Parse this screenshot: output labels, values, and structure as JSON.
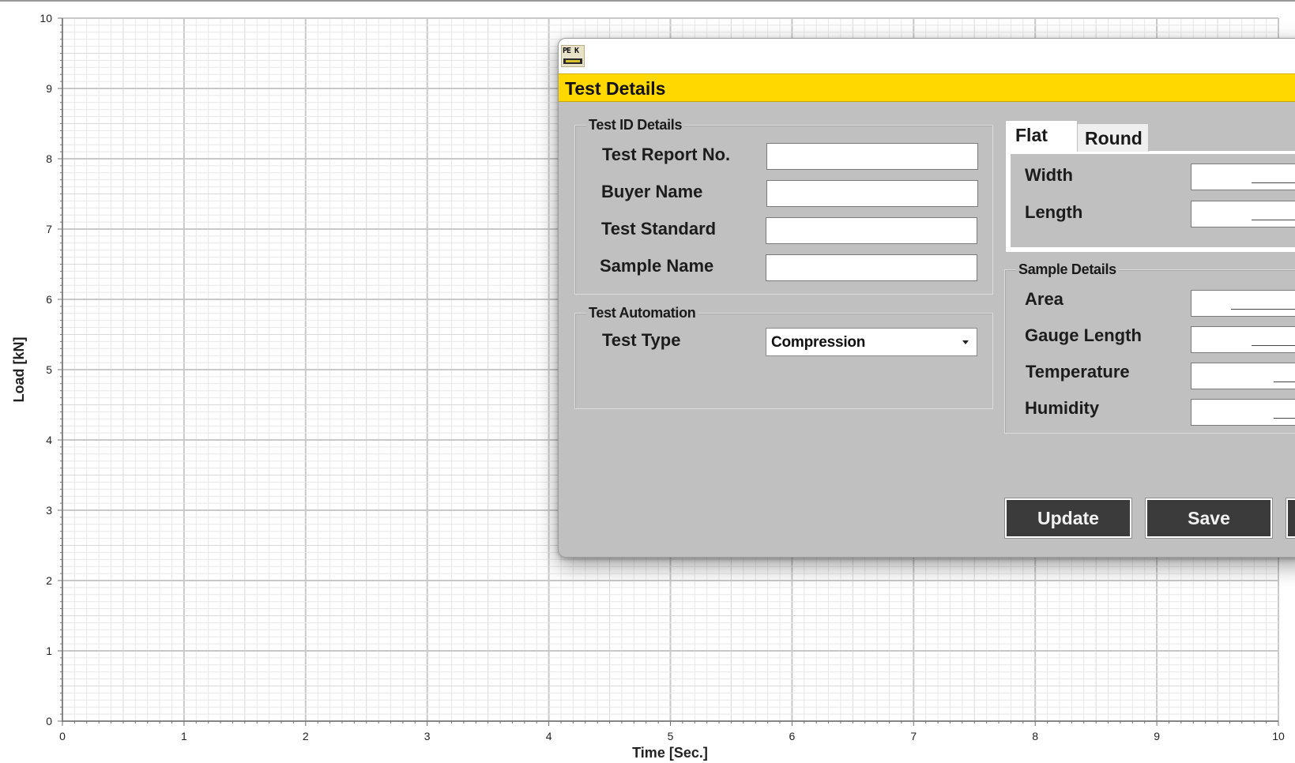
{
  "chart_data": {
    "type": "line",
    "title": "",
    "xlabel": "Time [Sec.]",
    "ylabel": "Load [kN]",
    "xlim": [
      0,
      10
    ],
    "ylim": [
      0,
      10
    ],
    "x_ticks": [
      0,
      1,
      2,
      3,
      4,
      5,
      6,
      7,
      8,
      9,
      10
    ],
    "y_ticks": [
      0,
      1,
      2,
      3,
      4,
      5,
      6,
      7,
      8,
      9,
      10
    ],
    "grid": true,
    "series": []
  },
  "dialog": {
    "logo_text": "PE K",
    "title": "Test Details",
    "test_id_group": {
      "legend": "Test ID Details",
      "fields": [
        {
          "label": "Test Report No.",
          "value": ""
        },
        {
          "label": "Buyer Name",
          "value": ""
        },
        {
          "label": "Test Standard",
          "value": ""
        },
        {
          "label": "Sample Name",
          "value": ""
        }
      ]
    },
    "automation_group": {
      "legend": "Test Automation",
      "test_type_label": "Test Type",
      "test_type_value": "Compression"
    },
    "tabs": [
      {
        "label": "Flat",
        "active": true
      },
      {
        "label": "Round",
        "active": false
      }
    ],
    "flat_fields": [
      {
        "label": "Width"
      },
      {
        "label": "Length"
      }
    ],
    "sample_group": {
      "legend": "Sample Details",
      "fields": [
        {
          "label": "Area"
        },
        {
          "label": "Gauge Length"
        },
        {
          "label": "Temperature"
        },
        {
          "label": "Humidity"
        }
      ]
    },
    "buttons": {
      "update": "Update",
      "save": "Save"
    }
  }
}
